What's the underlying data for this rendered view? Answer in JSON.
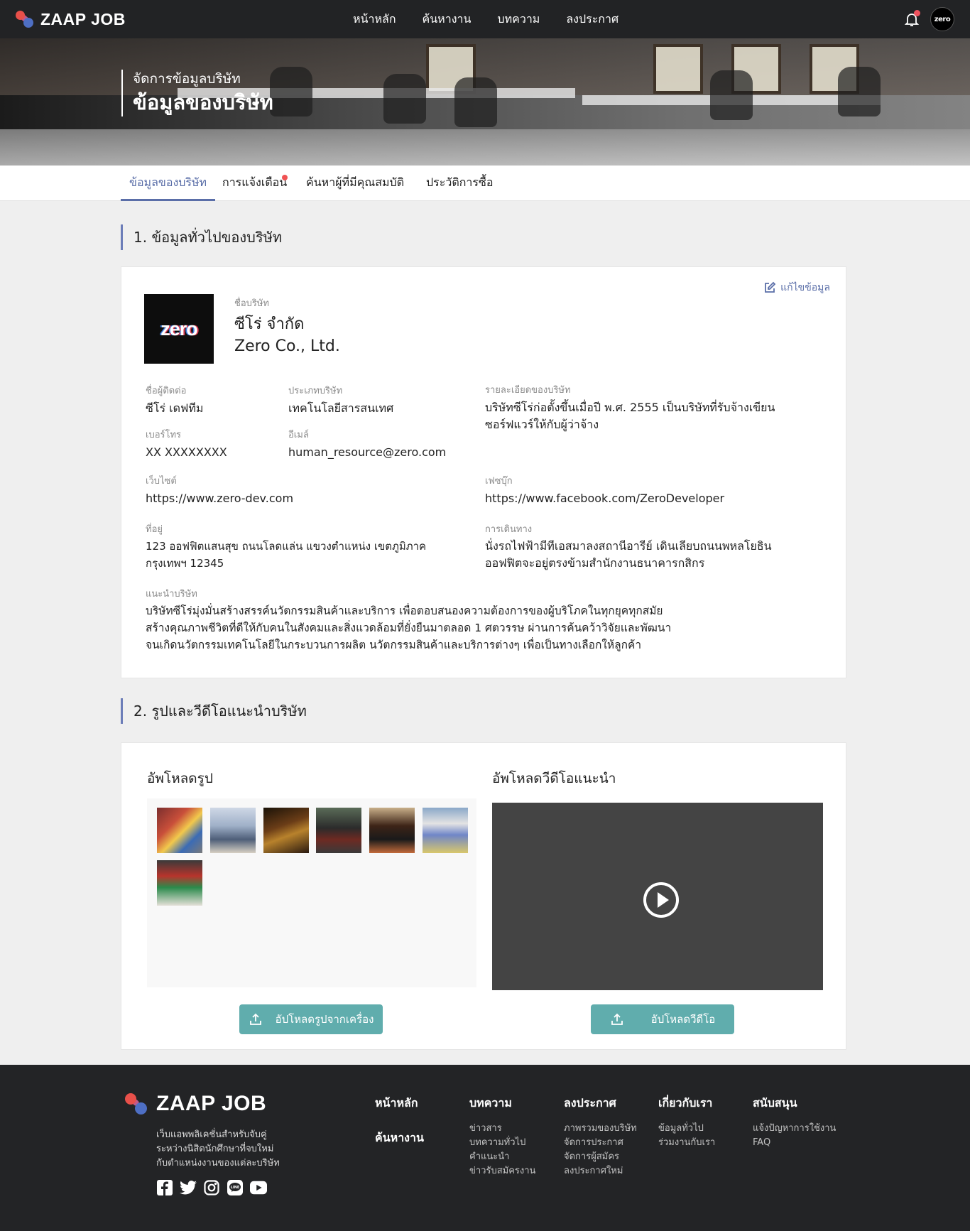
{
  "app": {
    "logo_text": "ZAAP JOB",
    "avatar_text": "zero"
  },
  "nav": {
    "items": [
      "หน้าหลัก",
      "ค้นหางาน",
      "บทความ",
      "ลงประกาศ"
    ]
  },
  "hero": {
    "subtitle": "จัดการข้อมูลบริษัท",
    "title": "ข้อมูลของบริษัท"
  },
  "tabs": [
    {
      "label": "ข้อมูลของบริษัท",
      "active": true
    },
    {
      "label": "การแจ้งเตือน",
      "active": false,
      "has_notification": true
    },
    {
      "label": "ค้นหาผู้ที่มีคุณสมบัติ",
      "active": false
    },
    {
      "label": "ประวัติการซื้อ",
      "active": false
    }
  ],
  "section1": {
    "title": "1. ข้อมูลทั่วไปของบริษัท",
    "edit_label": "แก้ไขข้อมูล",
    "logo_text": "zero",
    "company_name_label": "ชื่อบริษัท",
    "company_name_th": "ซีโร่ จำกัด",
    "company_name_en": "Zero Co., Ltd.",
    "contact_label": "ชื่อผู้ติดต่อ",
    "contact_value": "ซีโร่ เดฟทีม",
    "type_label": "ประเภทบริษัท",
    "type_value": "เทคโนโลยีสารสนเทศ",
    "detail_label": "รายละเอียดของบริษัท",
    "detail_value_1": "บริษัทซีโร่ก่อตั้งขึ้นเมื่อปี พ.ศ. 2555 เป็นบริษัทที่รับจ้างเขียน",
    "detail_value_2": "ซอร์ฟแวร์ให้กับผู้ว่าจ้าง",
    "phone_label": "เบอร์โทร",
    "phone_value": "XX XXXXXXXX",
    "email_label": "อีเมล์",
    "email_value": "human_resource@zero.com",
    "website_label": "เว็บไซต์",
    "website_value": "https://www.zero-dev.com",
    "facebook_label": "เฟซบุ๊ก",
    "facebook_value": "https://www.facebook.com/ZeroDeveloper",
    "address_label": "ที่อยู่",
    "address_value_1": "123 ออฟฟิตแสนสุข ถนนโลดแล่น แขวงตำแหน่ง เขตภูมิภาค",
    "address_value_2": "กรุงเทพฯ 12345",
    "travel_label": "การเดินทาง",
    "travel_value_1": "นั่งรถไฟฟ้ามีทีเอสมาลงสถานีอารีย์ เดินเลียบถนนพหลโยธิน",
    "travel_value_2": "ออฟฟิตจะอยู่ตรงข้ามสำนักงานธนาคารกสิกร",
    "intro_label": "แนะนำบริษัท",
    "intro_value_1": "บริษัทซีโร่มุ่งมั่นสร้างสรรค์นวัตกรรมสินค้าและบริการ เพื่อตอบสนองความต้องการของผู้บริโภคในทุกยุคทุกสมัย",
    "intro_value_2": "สร้างคุณภาพชีวิตที่ดีให้กับคนในสังคมและสิ่งแวดล้อมที่ยั่งยืนมาตลอด 1 ศตวรรษ ผ่านการค้นคว้าวิจัยและพัฒนา",
    "intro_value_3": "จนเกิดนวัตกรรมเทคโนโลยีในกระบวนการผลิต นวัตกรรมสินค้าและบริการต่างๆ เพื่อเป็นทางเลือกให้ลูกค้า"
  },
  "section2": {
    "title": "2. รูปและวีดีโอแนะนำบริษัท",
    "photo_heading": "อัพโหลดรูป",
    "video_heading": "อัพโหลดวีดีโอแนะนำ",
    "photo_button": "อัปโหลดรูปจากเครื่อง",
    "video_button": "อัปโหลดวีดีโอ",
    "photo_count": 7
  },
  "footer": {
    "logo_text": "ZAAP JOB",
    "desc_1": "เว็บแอพพลิเคชั่นสำหรับจับคู่",
    "desc_2": "ระหว่างนิสิตนักศึกษาที่จบใหม่",
    "desc_3": "กับตำแหน่งงานของแต่ละบริษัท",
    "socials": [
      "facebook-icon",
      "twitter-icon",
      "instagram-icon",
      "line-icon",
      "youtube-icon"
    ],
    "col_home": "หน้าหลัก",
    "col_search": "ค้นหางาน",
    "col_articles": "บทความ",
    "articles_links": [
      "ข่าวสาร",
      "บทความทั่วไป",
      "คำแนะนำ",
      "ข่าวรับสมัครงาน"
    ],
    "col_post": "ลงประกาศ",
    "post_links": [
      "ภาพรวมของบริษัท",
      "จัดการประกาศ",
      "จัดการผู้สมัคร",
      "ลงประกาศใหม่"
    ],
    "col_about": "เกี่ยวกับเรา",
    "about_links": [
      "ข้อมูลทั่วไป",
      "ร่วมงานกับเรา"
    ],
    "col_support": "สนับสนุน",
    "support_links": [
      "แจ้งปัญหาการใช้งาน",
      "FAQ"
    ]
  },
  "colors": {
    "accent": "#5a6ea8",
    "teal": "#60adad",
    "dark": "#232426",
    "notify": "#f05253"
  }
}
